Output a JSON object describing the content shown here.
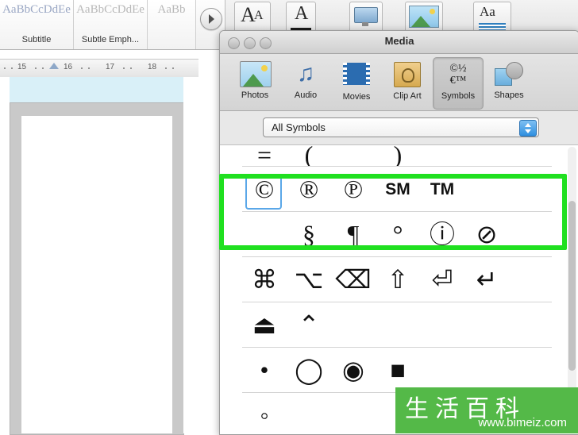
{
  "ribbon": {
    "styles": [
      {
        "sample": "AaBbCcDdEe",
        "caption": "Subtitle"
      },
      {
        "sample": "AaBbCcDdEe",
        "caption": "Subtle Emph..."
      },
      {
        "sample": "AaBb",
        "caption": ""
      }
    ],
    "scroll_button": "gallery-scroll-down",
    "buttons": [
      {
        "name": "text-styles",
        "glyph": "A"
      },
      {
        "name": "text-color",
        "glyph": "A"
      },
      {
        "name": "screen-capture",
        "glyph": ""
      },
      {
        "name": "picture",
        "glyph": ""
      },
      {
        "name": "font-size",
        "glyph": "Aa"
      }
    ]
  },
  "ruler": {
    "ticks": [
      "15",
      "16",
      "17",
      "18"
    ]
  },
  "media_window": {
    "title": "Media",
    "traffic_lights": [
      "close",
      "minimize",
      "zoom"
    ],
    "tabs": [
      {
        "label": "Photos",
        "icon": "photos-icon",
        "selected": false
      },
      {
        "label": "Audio",
        "icon": "music-note-icon",
        "selected": false
      },
      {
        "label": "Movies",
        "icon": "film-icon",
        "selected": false
      },
      {
        "label": "Clip Art",
        "icon": "clip-art-icon",
        "selected": false
      },
      {
        "label": "Symbols",
        "icon": "symbols-icon",
        "selected": true
      },
      {
        "label": "Shapes",
        "icon": "shapes-icon",
        "selected": false
      }
    ],
    "symbols_icon_glyphs": [
      "©½",
      "€™"
    ],
    "filter": {
      "value": "All Symbols",
      "name": "symbol-category-select"
    },
    "symbol_rows": [
      {
        "row": [
          "=",
          "(",
          " ",
          ")",
          " ",
          " "
        ],
        "partial": true
      },
      {
        "row": [
          "©",
          "®",
          "℗",
          "SM",
          "TM",
          ""
        ],
        "highlighted": true,
        "selected_index": 0
      },
      {
        "row": [
          "",
          "§",
          "¶",
          "°",
          "ⓘ",
          "⊘"
        ]
      },
      {
        "row": [
          "⌘",
          "⌥",
          "⌫",
          "⇧",
          "⏎",
          "↵"
        ]
      },
      {
        "row": [
          "⏏",
          "⌃",
          "",
          "",
          "",
          ""
        ]
      },
      {
        "row": [
          "•",
          "◯",
          "◉",
          "■",
          "",
          ""
        ]
      },
      {
        "row": [
          "◦",
          "",
          "",
          "",
          "",
          ""
        ],
        "partial": true
      }
    ]
  },
  "highlight": {
    "name": "green-highlight-box",
    "color": "#20e020"
  },
  "watermark": {
    "cjk": "生活百科",
    "url": "www.bimeiz.com",
    "background": "#54b948"
  }
}
